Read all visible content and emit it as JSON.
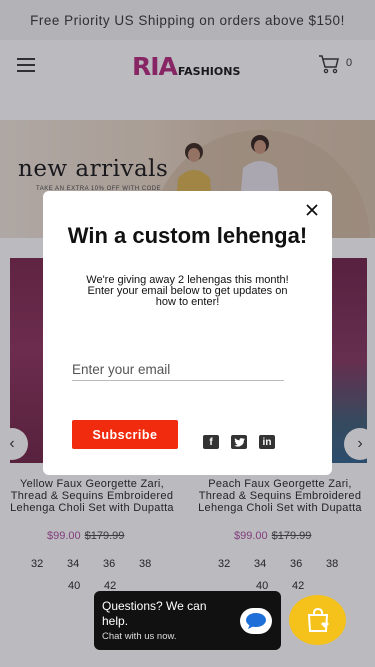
{
  "announcement": "Free Priority US Shipping on orders above $150!",
  "header": {
    "logo_main": "RIA",
    "logo_sub": "FASHIONS",
    "cart_count": "0"
  },
  "banner": {
    "title": "new arrivals",
    "subtitle": "TAKE AN EXTRA 10% OFF WITH CODE"
  },
  "products": [
    {
      "name": "Yellow Faux Georgette Zari, Thread & Sequins Embroidered Lehenga Choli Set with Dupatta",
      "price": "$99.00",
      "compare_price": "$179.99",
      "sizes_row1": [
        "32",
        "34",
        "36",
        "38"
      ],
      "sizes_row2": [
        "40",
        "42"
      ]
    },
    {
      "name": "Peach Faux Georgette Zari, Thread & Sequins Embroidered Lehenga Choli Set with Dupatta",
      "price": "$99.00",
      "compare_price": "$179.99",
      "sizes_row1": [
        "32",
        "34",
        "36",
        "38"
      ],
      "sizes_row2": [
        "40",
        "42"
      ]
    }
  ],
  "modal": {
    "title": "Win a custom lehenga!",
    "text": "We're giving away 2 lehengas this month! Enter your email below to get updates on how to enter!",
    "email_placeholder": "Enter your email",
    "subscribe_label": "Subscribe",
    "social_icons": [
      "facebook-icon",
      "twitter-icon",
      "linkedin-icon"
    ]
  },
  "chat": {
    "title": "Questions? We can help.",
    "subtitle": "Chat with us now."
  },
  "colors": {
    "brand": "#b5267b",
    "subscribe": "#f12b0e",
    "shop_button": "#f5c21b",
    "price": "#b04aa0"
  }
}
